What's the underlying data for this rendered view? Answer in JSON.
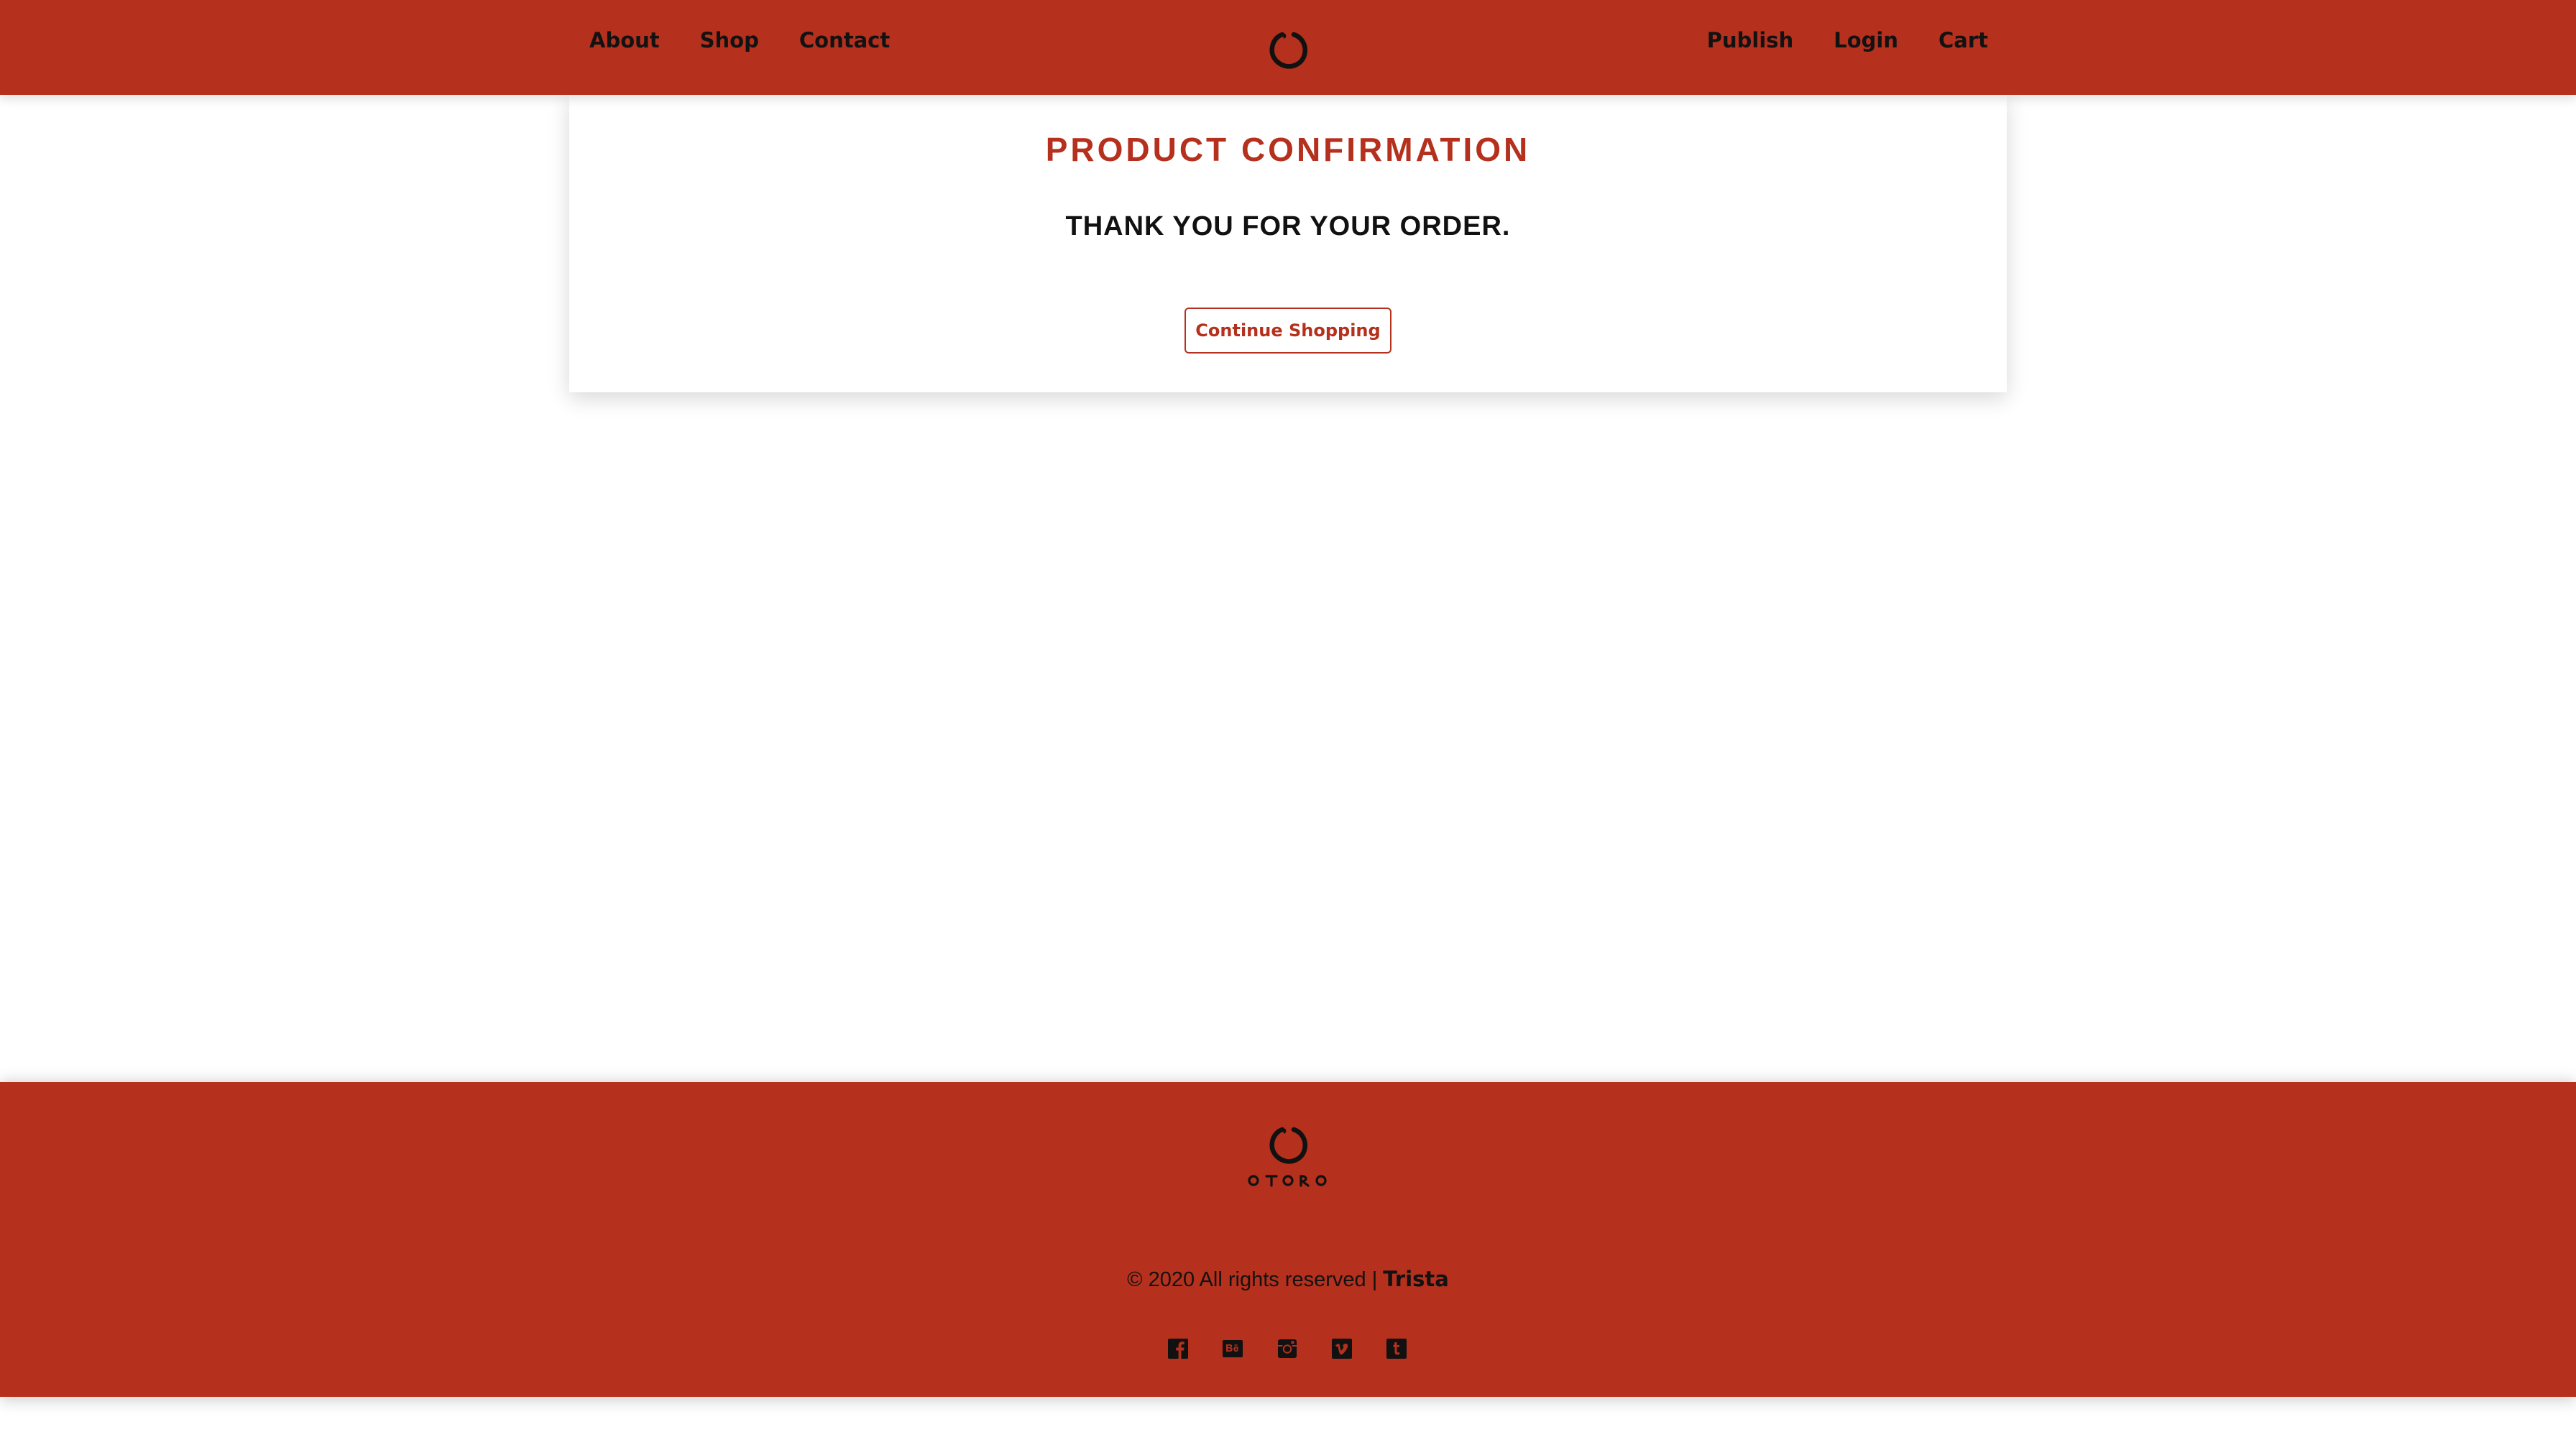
{
  "header": {
    "nav_left": [
      {
        "label": "About"
      },
      {
        "label": "Shop"
      },
      {
        "label": "Contact"
      }
    ],
    "nav_right": [
      {
        "label": "Publish"
      },
      {
        "label": "Login"
      },
      {
        "label": "Cart"
      }
    ],
    "logo_icon": "ensō-circle-logo"
  },
  "confirmation": {
    "title": "PRODUCT CONFIRMATION",
    "message": "THANK YOU FOR YOUR ORDER.",
    "button_label": "Continue Shopping"
  },
  "footer": {
    "wordmark": "OTORO",
    "copyright_text": "© 2020 All rights reserved | ",
    "author": "Trista",
    "social": [
      {
        "name": "facebook",
        "icon": "facebook-icon"
      },
      {
        "name": "behance",
        "icon": "behance-icon"
      },
      {
        "name": "instagram",
        "icon": "instagram-icon"
      },
      {
        "name": "vimeo",
        "icon": "vimeo-icon"
      },
      {
        "name": "tumblr",
        "icon": "tumblr-icon"
      }
    ]
  },
  "colors": {
    "brand": "#b5301d",
    "text": "#121212",
    "background": "#ffffff"
  }
}
